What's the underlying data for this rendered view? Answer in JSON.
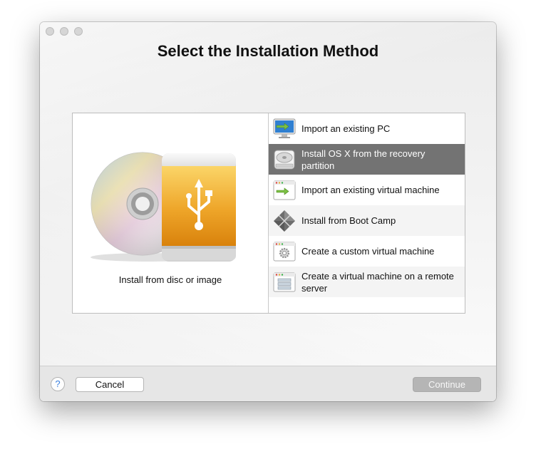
{
  "window": {
    "title": "Select the Installation Method"
  },
  "left_panel": {
    "caption": "Install from disc or image",
    "icons": [
      "disc-icon",
      "usb-drive-icon"
    ]
  },
  "methods": [
    {
      "label": "Import an existing PC",
      "icon": "pc-monitor-icon",
      "selected": false
    },
    {
      "label": "Install OS X from the recovery partition",
      "icon": "hard-drive-icon",
      "selected": true
    },
    {
      "label": "Import an existing virtual machine",
      "icon": "vm-window-icon",
      "selected": false
    },
    {
      "label": "Install from Boot Camp",
      "icon": "boot-camp-icon",
      "selected": false
    },
    {
      "label": "Create a custom virtual machine",
      "icon": "gear-window-icon",
      "selected": false
    },
    {
      "label": "Create a virtual machine on a remote server",
      "icon": "server-window-icon",
      "selected": false
    }
  ],
  "footer": {
    "help_label": "?",
    "cancel_label": "Cancel",
    "continue_label": "Continue"
  },
  "colors": {
    "selected_row": "#737373",
    "usb_orange": "#eb9b1e"
  }
}
